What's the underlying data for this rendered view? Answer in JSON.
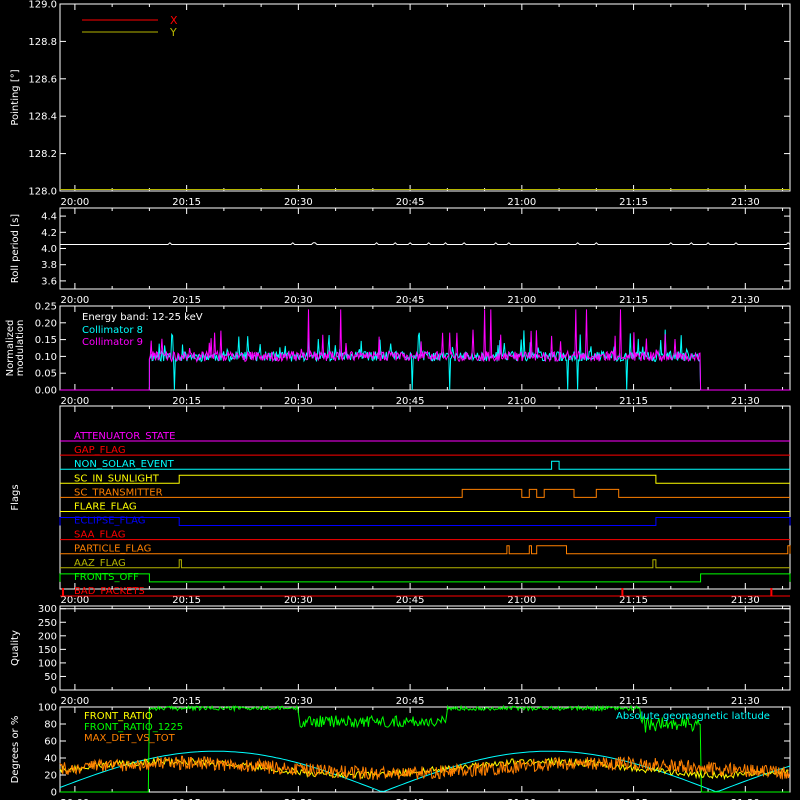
{
  "figure": {
    "background": "#000000",
    "foreground": "#ffffff",
    "time_ticks": [
      "20:00",
      "20:15",
      "20:30",
      "20:45",
      "21:00",
      "21:15",
      "21:30"
    ],
    "time_range_minutes": [
      -2,
      96
    ],
    "time_tick_minutes": [
      0,
      15,
      30,
      45,
      60,
      75,
      90
    ]
  },
  "chart_data": [
    {
      "type": "line",
      "id": "pointing",
      "ylabel": "Pointing [°]",
      "ylim": [
        128.0,
        129.0
      ],
      "yticks": [
        "128.0",
        "128.2",
        "128.4",
        "128.6",
        "128.8",
        "129.0"
      ],
      "ytick_values": [
        128.0,
        128.2,
        128.4,
        128.6,
        128.8,
        129.0
      ],
      "legend": "top-left",
      "series": [
        {
          "name": "X",
          "color": "#ff0000",
          "values": []
        },
        {
          "name": "Y",
          "color": "#b5b500",
          "values": []
        }
      ]
    },
    {
      "type": "line",
      "id": "roll",
      "ylabel": "Roll period [s]",
      "ylim": [
        3.5,
        4.5
      ],
      "yticks": [
        "3.6",
        "3.8",
        "4.0",
        "4.2",
        "4.4"
      ],
      "ytick_values": [
        3.6,
        3.8,
        4.0,
        4.2,
        4.4
      ],
      "series": [
        {
          "color": "#ffffff",
          "constant": 4.05
        }
      ]
    },
    {
      "type": "line",
      "id": "modulation",
      "ylabel": "Normalized modulation",
      "ylim": [
        0,
        0.25
      ],
      "yticks": [
        "0.00",
        "0.05",
        "0.10",
        "0.15",
        "0.20",
        "0.25"
      ],
      "ytick_values": [
        0,
        0.05,
        0.1,
        0.15,
        0.2,
        0.25
      ],
      "annotations": [
        "Energy band: 12-25 keV"
      ],
      "legend": "top-left",
      "active_interval": [
        10,
        84
      ],
      "series": [
        {
          "name": "Collimator 8",
          "color": "#00ffff",
          "baseline": 0.1
        },
        {
          "name": "Collimator 9",
          "color": "#ff00ff",
          "baseline": 0.1
        }
      ]
    },
    {
      "type": "line",
      "id": "flags",
      "ylabel": "Flags",
      "series": [
        {
          "name": "ATTENUATOR_STATE",
          "color": "#ff00ff",
          "steps": []
        },
        {
          "name": "GAP_FLAG",
          "color": "#ff0000",
          "steps": []
        },
        {
          "name": "NON_SOLAR_EVENT",
          "color": "#00ffff",
          "steps": [
            [
              64,
              65
            ]
          ]
        },
        {
          "name": "SC_IN_SUNLIGHT",
          "color": "#ffff00",
          "steps": [
            [
              14,
              78
            ]
          ]
        },
        {
          "name": "SC_TRANSMITTER",
          "color": "#ff8000",
          "steps": [
            [
              52,
              60
            ],
            [
              61,
              62
            ],
            [
              63,
              67
            ],
            [
              70,
              73
            ]
          ]
        },
        {
          "name": "FLARE_FLAG",
          "color": "#ffff00",
          "steps": []
        },
        {
          "name": "ECLIPSE_FLAG",
          "color": "#0000ff",
          "steps": [
            [
              -2,
              14
            ],
            [
              78,
              96
            ]
          ]
        },
        {
          "name": "SAA_FLAG",
          "color": "#ff0000",
          "steps": []
        },
        {
          "name": "PARTICLE_FLAG",
          "color": "#ff8000",
          "steps": [
            [
              58,
              58.3
            ],
            [
              61,
              61.3
            ],
            [
              62,
              66
            ],
            [
              95.7,
              96
            ]
          ]
        },
        {
          "name": "AAZ_FLAG",
          "color": "#b5b500",
          "steps": [
            [
              14,
              14.3
            ],
            [
              77.6,
              78
            ]
          ]
        },
        {
          "name": "FRONTS_OFF",
          "color": "#00ff00",
          "steps": [
            [
              -2,
              10
            ],
            [
              84,
              96
            ]
          ]
        },
        {
          "name": "BAD_PACKETS",
          "color": "#ff0000",
          "spikes": [
            -1.6,
            73.5,
            93.5
          ]
        }
      ]
    },
    {
      "type": "line",
      "id": "quality",
      "ylabel": "Quality",
      "ylim": [
        0,
        310
      ],
      "yticks": [
        "0",
        "50",
        "100",
        "150",
        "200",
        "250",
        "300"
      ],
      "ytick_values": [
        0,
        50,
        100,
        150,
        200,
        250,
        300
      ],
      "series": [
        {
          "color": "#ffffff",
          "constant": 300
        }
      ]
    },
    {
      "type": "line",
      "id": "ratios",
      "ylabel": "Degrees or %",
      "ylim": [
        0,
        100
      ],
      "yticks": [
        "0",
        "20",
        "40",
        "60",
        "80",
        "100"
      ],
      "ytick_values": [
        0,
        20,
        40,
        60,
        80,
        100
      ],
      "legend": "top-left",
      "series": [
        {
          "name": "FRONT_RATIO",
          "color": "#ffff00"
        },
        {
          "name": "FRONT_RATIO_1225",
          "color": "#00ff00"
        },
        {
          "name": "MAX_DET_VS_TOT",
          "color": "#ff8000"
        },
        {
          "name": "Absolute geomagnetic latitude",
          "color": "#00ffff"
        }
      ]
    }
  ]
}
